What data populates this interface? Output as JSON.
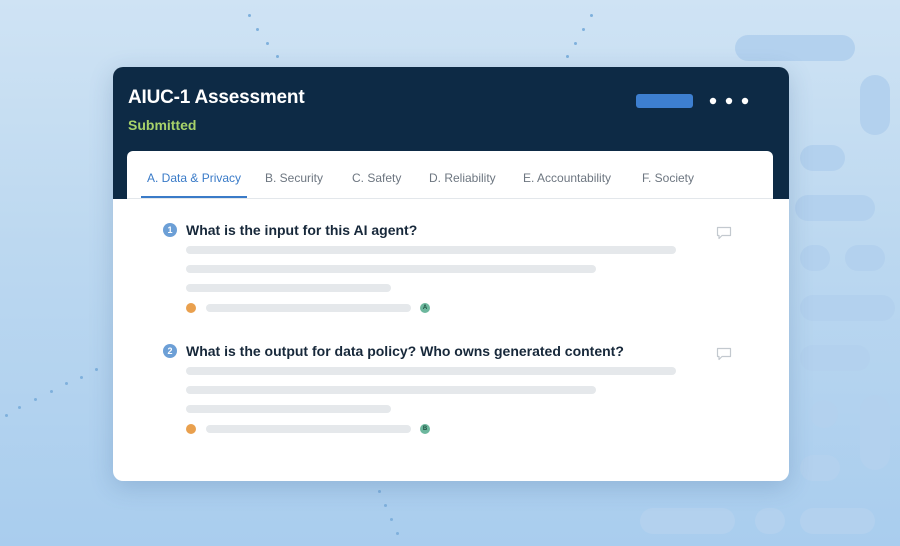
{
  "assessment": {
    "title": "AIUC-1 Assessment",
    "status": "Submitted"
  },
  "tabs": [
    {
      "label": "A. Data & Privacy",
      "active": true
    },
    {
      "label": "B. Security",
      "active": false
    },
    {
      "label": "C. Safety",
      "active": false
    },
    {
      "label": "D. Reliability",
      "active": false
    },
    {
      "label": "E. Accountability",
      "active": false
    },
    {
      "label": "F. Society",
      "active": false
    }
  ],
  "questions": [
    {
      "number": "1",
      "text": "What is the input for this AI agent?",
      "tag": "A"
    },
    {
      "number": "2",
      "text": "What is the output for data policy? Who owns generated content?",
      "tag": "B"
    }
  ],
  "icons": {
    "more": "ellipsis-horizontal-icon",
    "comment": "comment-bubble-icon"
  },
  "colors": {
    "header_bg": "#0d2a45",
    "status": "#a7d26a",
    "accent": "#3a7bc8",
    "primary_button": "#3d7fd0",
    "author_dot": "#e9a04e",
    "tag_badge": "#6cb79d"
  }
}
